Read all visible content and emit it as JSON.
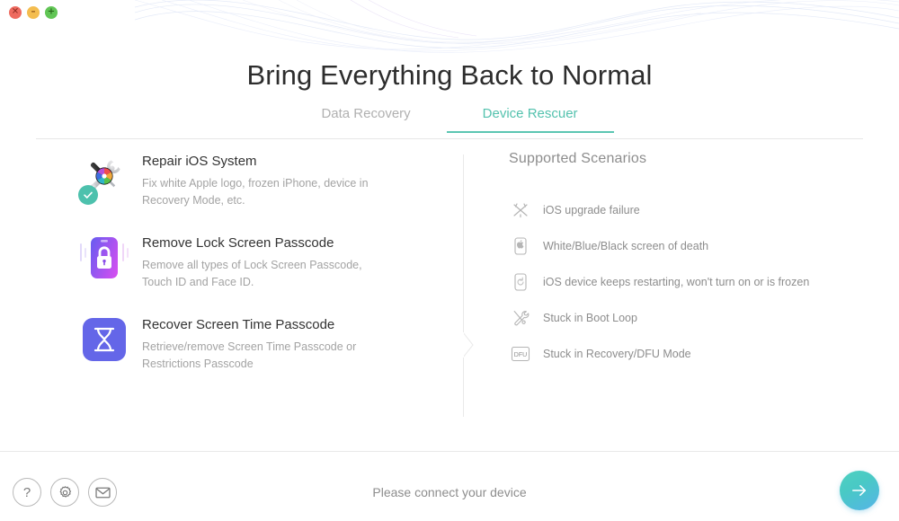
{
  "window": {
    "controls": [
      {
        "name": "close",
        "glyph": "✕",
        "color": "#ee6a5f"
      },
      {
        "name": "minimize",
        "glyph": "–",
        "color": "#f4bd4f"
      },
      {
        "name": "maximize",
        "glyph": "+",
        "color": "#61c555"
      }
    ]
  },
  "header": {
    "title": "Bring Everything Back to Normal"
  },
  "tabs": [
    {
      "label": "Data Recovery",
      "active": false
    },
    {
      "label": "Device Rescuer",
      "active": true
    }
  ],
  "features": [
    {
      "title": "Repair iOS System",
      "desc": "Fix white Apple logo, frozen iPhone, device in Recovery Mode, etc.",
      "icon": "screwdriver-wrench-icon",
      "selected": true
    },
    {
      "title": "Remove Lock Screen Passcode",
      "desc": "Remove all types of Lock Screen Passcode, Touch ID and Face ID.",
      "icon": "phone-lock-icon",
      "selected": false
    },
    {
      "title": "Recover Screen Time Passcode",
      "desc": "Retrieve/remove Screen Time Passcode or Restrictions Passcode",
      "icon": "hourglass-icon",
      "selected": false
    }
  ],
  "scenarios": {
    "heading": "Supported Scenarios",
    "items": [
      {
        "label": "iOS upgrade failure",
        "icon": "crossed-out-icon"
      },
      {
        "label": "White/Blue/Black screen of death",
        "icon": "phone-apple-icon"
      },
      {
        "label": "iOS device keeps restarting, won't turn on or is frozen",
        "icon": "phone-restart-icon"
      },
      {
        "label": "Stuck in Boot Loop",
        "icon": "tools-icon"
      },
      {
        "label": "Stuck in Recovery/DFU Mode",
        "icon": "dfu-icon",
        "text": "DFU"
      }
    ]
  },
  "footer": {
    "buttons": [
      {
        "name": "help",
        "glyph": "?"
      },
      {
        "name": "settings",
        "glyph": "gear-icon"
      },
      {
        "name": "mail",
        "glyph": "mail-icon"
      }
    ],
    "status": "Please connect your device",
    "next_label": "arrow-right-icon"
  },
  "colors": {
    "accent_teal": "#54c2ae",
    "tab_underline": "#5cc6b2",
    "check_badge": "#4dc1ad",
    "next_gradient_from": "#4fd1c0",
    "next_gradient_to": "#55b4e8",
    "lock_gradient_from": "#6f5bf0",
    "lock_gradient_to": "#d24ff0",
    "hourglass_bg": "#6466e8",
    "title_text": "#2d2d2d",
    "muted_text": "#8d8d8d"
  }
}
